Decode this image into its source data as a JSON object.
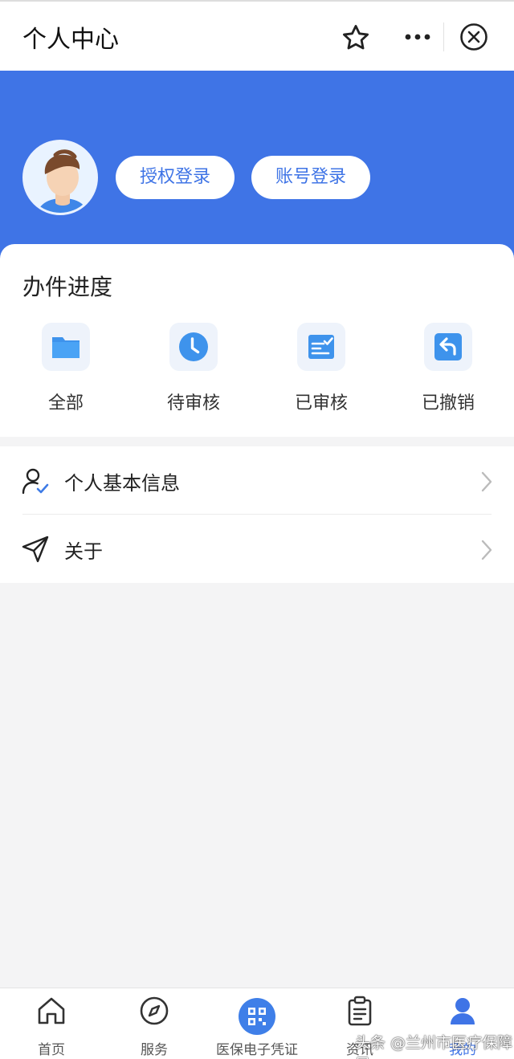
{
  "header": {
    "title": "个人中心",
    "icons": [
      "star-icon",
      "more-icon",
      "close-icon"
    ]
  },
  "hero": {
    "accent": "#3f74e6",
    "auth_login_label": "授权登录",
    "account_login_label": "账号登录"
  },
  "progress": {
    "title": "办件进度",
    "items": [
      {
        "label": "全部",
        "icon": "folder-icon"
      },
      {
        "label": "待审核",
        "icon": "clock-icon"
      },
      {
        "label": "已审核",
        "icon": "checklist-icon"
      },
      {
        "label": "已撤销",
        "icon": "undo-icon"
      }
    ]
  },
  "menu": {
    "items": [
      {
        "label": "个人基本信息",
        "icon": "person-check-icon"
      },
      {
        "label": "关于",
        "icon": "navigation-icon"
      }
    ]
  },
  "tabs": [
    {
      "label": "首页",
      "icon": "home-icon"
    },
    {
      "label": "服务",
      "icon": "compass-icon"
    },
    {
      "label": "医保电子凭证",
      "icon": "qr-code-icon"
    },
    {
      "label": "资讯",
      "icon": "clipboard-icon"
    },
    {
      "label": "我的",
      "icon": "user-icon",
      "active": true
    }
  ],
  "watermark": "头条 @兰州市医疗保障局"
}
